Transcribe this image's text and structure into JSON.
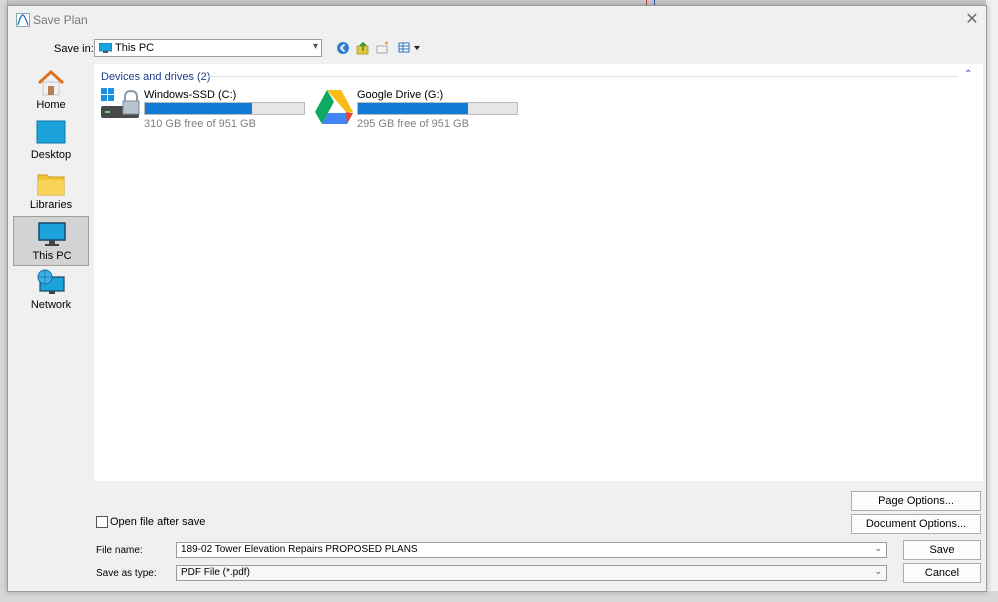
{
  "dialog": {
    "title": "Save Plan",
    "close_glyph": "✕"
  },
  "save_in": {
    "label": "Save in:",
    "value": "This PC",
    "chevron": "▾"
  },
  "toolbar": {
    "icons": [
      "back-icon",
      "up-folder-icon",
      "new-folder-icon",
      "view-menu-icon"
    ]
  },
  "places": [
    {
      "label": "Home",
      "icon": "home-icon"
    },
    {
      "label": "Desktop",
      "icon": "desktop-icon"
    },
    {
      "label": "Libraries",
      "icon": "libraries-icon"
    },
    {
      "label": "This PC",
      "icon": "this-pc-icon",
      "active": true
    },
    {
      "label": "Network",
      "icon": "network-icon"
    }
  ],
  "list": {
    "group_header": "Devices and drives (2)",
    "collapse_glyph": "⌃",
    "drives": [
      {
        "name": "Windows-SSD (C:)",
        "free_text": "310 GB free of 951 GB",
        "used_fraction": 0.674,
        "icon": "windows-drive-icon"
      },
      {
        "name": "Google Drive (G:)",
        "free_text": "295 GB free of 951 GB",
        "used_fraction": 0.69,
        "icon": "google-drive-icon"
      }
    ]
  },
  "options": {
    "page_options": "Page Options...",
    "document_options": "Document Options...",
    "open_after_save": "Open file after save"
  },
  "file_name": {
    "label": "File name:",
    "value": "189-02 Tower Elevation Repairs PROPOSED PLANS"
  },
  "save_as_type": {
    "label": "Save as type:",
    "value": "PDF File (*.pdf)"
  },
  "actions": {
    "save": "Save",
    "cancel": "Cancel"
  },
  "colors": {
    "accent": "#0f7bd6",
    "group_header": "#1e3f8a"
  }
}
